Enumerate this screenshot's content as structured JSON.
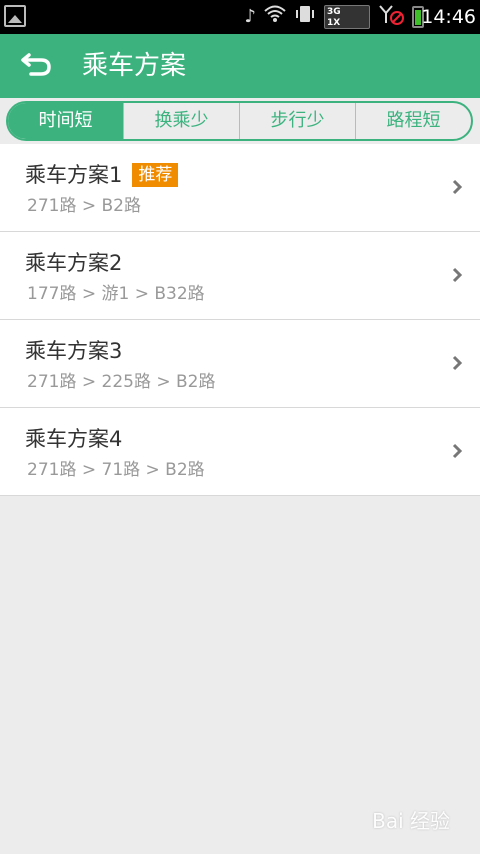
{
  "status_bar": {
    "time": "14:46",
    "network_line1": "3G",
    "network_line2": "1X",
    "icons": [
      "gallery-icon",
      "music-mute-icon",
      "wifi-icon",
      "vibrate-icon",
      "network-signal-icon",
      "no-signal-icon",
      "battery-icon"
    ]
  },
  "header": {
    "title": "乘车方案",
    "back_icon": "back-arrow-icon",
    "color": "#3cb37f"
  },
  "tabs": [
    {
      "label": "时间短",
      "active": true
    },
    {
      "label": "换乘少",
      "active": false
    },
    {
      "label": "步行少",
      "active": false
    },
    {
      "label": "路程短",
      "active": false
    }
  ],
  "plans": [
    {
      "title": "乘车方案1",
      "badge": "推荐",
      "route": "271路 > B2路"
    },
    {
      "title": "乘车方案2",
      "route": "177路 > 游1 > B32路"
    },
    {
      "title": "乘车方案3",
      "route": "271路 > 225路 > B2路"
    },
    {
      "title": "乘车方案4",
      "route": "271路 > 71路 > B2路"
    }
  ],
  "badge_color": "#f08c00",
  "watermark": "Bai 经验"
}
